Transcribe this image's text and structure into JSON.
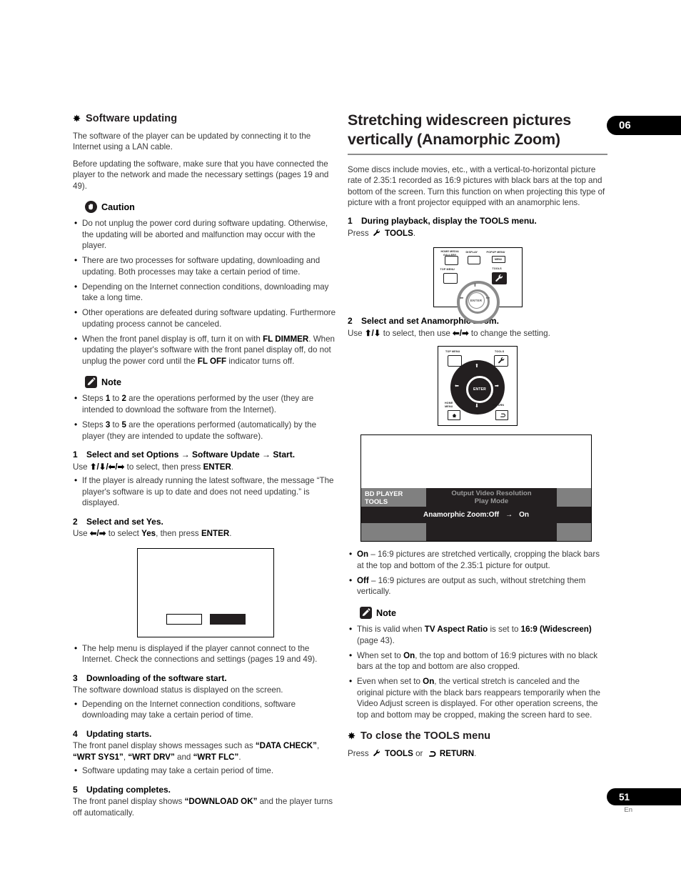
{
  "page": {
    "chapter_tab": "06",
    "page_number": "51",
    "language_code": "En"
  },
  "left_column": {
    "heading": "Software updating",
    "intro_paragraphs": [
      "The software of the player can be updated by connecting it to the Internet using a LAN cable.",
      "Before updating the software, make sure that you have connected the player to the network and made the necessary settings (pages 19 and 49)."
    ],
    "caution": {
      "label": "Caution",
      "icon": "hand-stop-icon",
      "items": [
        "Do not unplug the power cord during software updating. Otherwise, the updating will be aborted and malfunction may occur with the player.",
        "There are two processes for software updating, downloading and updating. Both processes may take a certain period of time.",
        "Depending on the Internet connection conditions, downloading may take a long time.",
        "Other operations are defeated during software updating. Furthermore updating process cannot be canceled.",
        "When the front panel display is off, turn it on with FL DIMMER. When updating the player's software with the front panel display off, do not unplug the power cord until the FL OFF indicator turns off."
      ]
    },
    "note": {
      "label": "Note",
      "icon": "pencil-icon",
      "items": [
        "Steps 1 to 2 are the operations performed by the user (they are intended to download the software from the Internet).",
        "Steps 3 to 5 are the operations performed (automatically) by the player (they are intended to update the software)."
      ]
    },
    "steps": [
      {
        "num": "1",
        "title": "Select and set Options → Software Update → Start.",
        "body": "Use ↑/↓/←/→ to select, then press ENTER.",
        "bullets": [
          "If the player is already running the latest software, the message “The player's software is up to date and does not need updating.” is displayed."
        ]
      },
      {
        "num": "2",
        "title": "Select and set Yes.",
        "body": "Use ←/→ to select Yes, then press ENTER.",
        "bullets": [
          "The help menu is displayed if the player cannot connect to the Internet. Check the connections and settings (pages 19 and 49)."
        ]
      },
      {
        "num": "3",
        "title": "Downloading of the software start.",
        "body": "The software download status is displayed on the screen.",
        "bullets": [
          "Depending on the Internet connection conditions, software downloading may take a certain period of time."
        ]
      },
      {
        "num": "4",
        "title": "Updating starts.",
        "body": "The front panel display shows messages such as “DATA CHECK”, “WRT SYS1”, “WRT DRV” and “WRT FLC”.",
        "bullets": [
          "Software updating may take a certain period of time."
        ]
      },
      {
        "num": "5",
        "title": "Updating completes.",
        "body": "The front panel display shows “DOWNLOAD OK” and the player turns off automatically.",
        "bullets": []
      }
    ],
    "confirm_screen": {
      "name": "yes-no-confirmation-screen",
      "button_unselected": "",
      "button_selected": ""
    }
  },
  "right_column": {
    "heading_line1": "Stretching widescreen pictures",
    "heading_line2": "vertically (Anamorphic Zoom)",
    "intro": "Some discs include movies, etc., with a vertical-to-horizontal picture rate of 2.35:1 recorded as 16:9 pictures with black bars at the top and bottom of the screen. Turn this function on when projecting this type of picture with a front projector equipped with an anamorphic lens.",
    "step1": {
      "num": "1",
      "title": "During playback, display the TOOLS menu.",
      "press_label": "Press",
      "press_key": "TOOLS",
      "press_suffix": "."
    },
    "step2": {
      "num": "2",
      "title": "Select and set Anamorphic Zoom.",
      "body": "Use ↑/↓ to select, then use ←/→ to change the setting."
    },
    "remote_top": {
      "name": "remote-diagram-tools",
      "labels": {
        "home_media_gallery": "HOME MEDIA GALLERY",
        "display": "DISPLAY",
        "popup_menu": "POPUP MENU",
        "popup_menu_button": "MENU",
        "top_menu": "TOP MENU",
        "tools": "TOOLS",
        "enter": "ENTER"
      }
    },
    "remote_bottom": {
      "name": "remote-diagram-cursor",
      "labels": {
        "top_menu": "TOP MENU",
        "tools": "TOOLS",
        "home_menu": "HOME MENU",
        "return": "RETURN",
        "enter": "ENTER"
      }
    },
    "osd": {
      "title_line1": "BD PLAYER",
      "title_line2": "TOOLS",
      "items": [
        "Output Video Resolution",
        "Play Mode"
      ],
      "selected_item": "Anamorphic Zoom:Off",
      "selected_arrow": "→",
      "selected_value": "On"
    },
    "option_bullets": [
      "On – 16:9 pictures are stretched vertically, cropping the black bars at the top and bottom of the 2.35:1 picture for output.",
      "Off – 16:9 pictures are output as such, without stretching them vertically."
    ],
    "note": {
      "label": "Note",
      "icon": "pencil-icon",
      "items": [
        "This is valid when TV Aspect Ratio is set to 16:9 (Widescreen) (page 43).",
        "When set to On, the top and bottom of 16:9 pictures with no black bars at the top and bottom are also cropped.",
        "Even when set to On, the vertical stretch is canceled and the original picture with the black bars reappears temporarily when the Video Adjust screen is displayed. For other operation screens, the top and bottom may be cropped, making the screen hard to see."
      ]
    },
    "close_section": {
      "heading": "To close the TOOLS menu",
      "press_label": "Press",
      "key1": "TOOLS",
      "conjunction": "or",
      "key2": "RETURN",
      "suffix": "."
    }
  },
  "colors": {
    "text": "#3a3a3a",
    "bold_text": "#000000",
    "rule": "#8c8c8c",
    "osd_gray": "#808080",
    "osd_dark": "#231f20",
    "osd_dim_text": "#9a9a9a"
  }
}
